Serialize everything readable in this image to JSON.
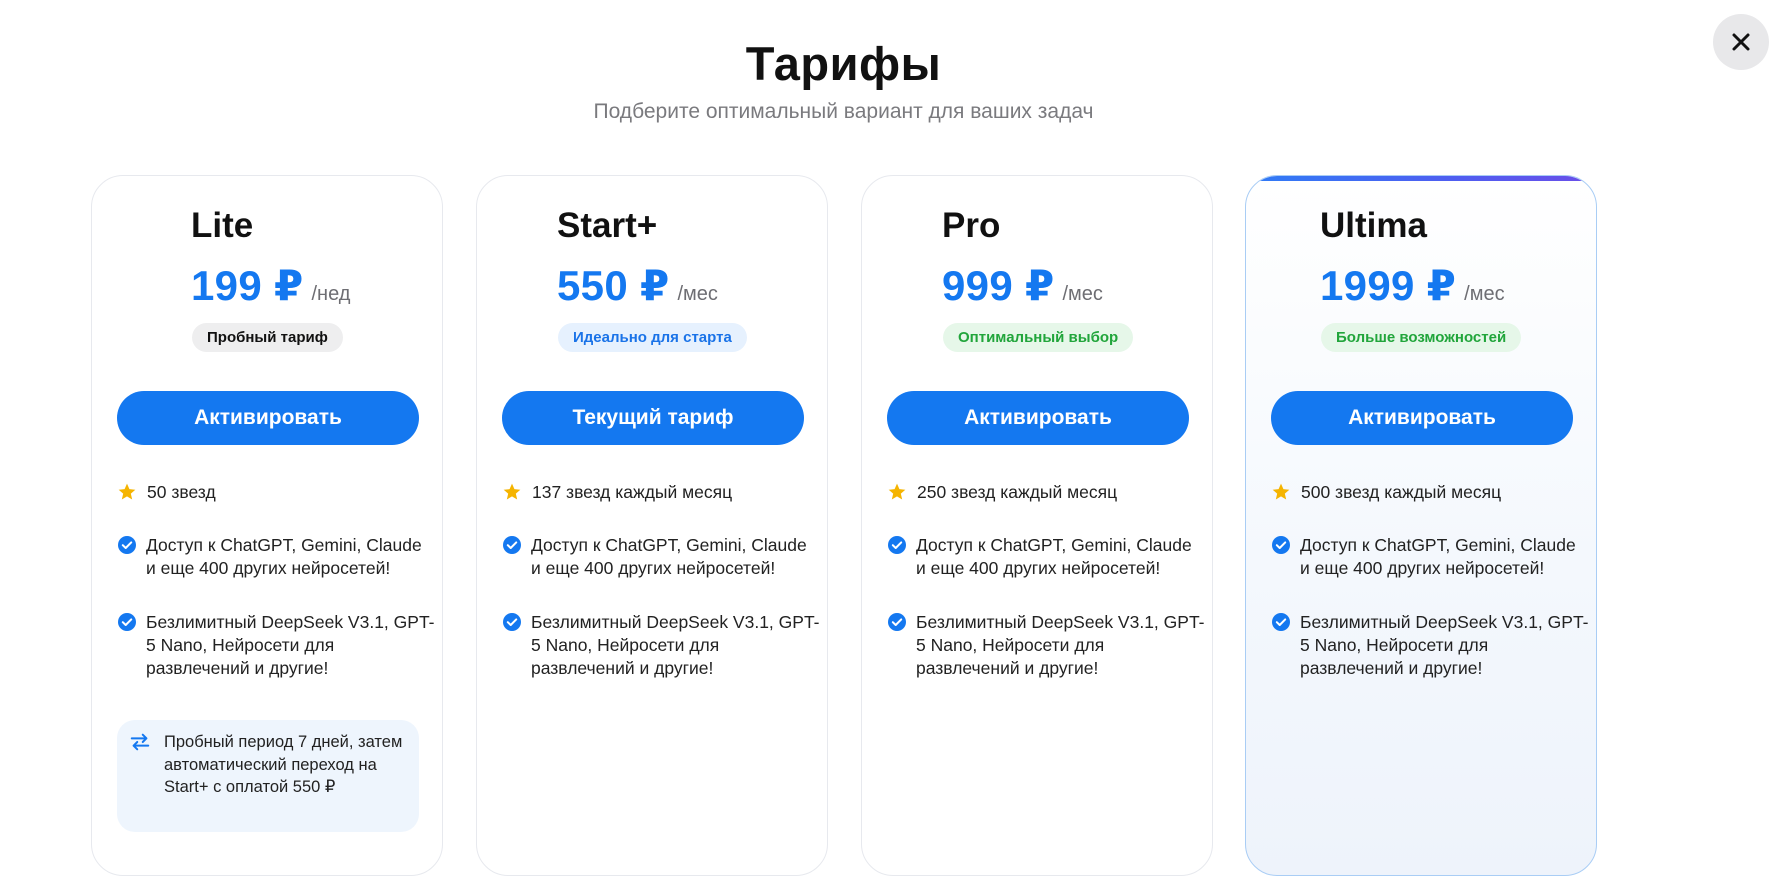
{
  "header": {
    "title": "Тарифы",
    "subtitle": "Подберите оптимальный вариант для ваших задач"
  },
  "close_icon": "close-icon",
  "colors": {
    "accent": "#1478f0",
    "badge_blue": "#1a73e8",
    "badge_green": "#21a53b",
    "star": "#f5b400"
  },
  "plans": [
    {
      "name": "Lite",
      "price": "199 ₽",
      "period": "/нед",
      "badge": "Пробный тариф",
      "button": "Активировать",
      "features": [
        "50 звезд",
        "Доступ к ChatGPT, Gemini, Claude и еще 400 других нейросетей!",
        "Безлимитный DeepSeek V3.1, GPT-5 Nano, Нейросети для развлечений и другие!"
      ],
      "note": "Пробный период 7 дней, затем автоматический переход на Start+ с оплатой 550 ₽"
    },
    {
      "name": "Start+",
      "price": "550 ₽",
      "period": "/мес",
      "badge": "Идеально для старта",
      "button": "Текущий тариф",
      "features": [
        "137 звезд каждый месяц",
        "Доступ к ChatGPT, Gemini, Claude и еще 400 других нейросетей!",
        "Безлимитный DeepSeek V3.1, GPT-5 Nano, Нейросети для развлечений и другие!"
      ]
    },
    {
      "name": "Pro",
      "price": "999 ₽",
      "period": "/мес",
      "badge": "Оптимальный выбор",
      "button": "Активировать",
      "features": [
        "250 звезд каждый месяц",
        "Доступ к ChatGPT, Gemini, Claude и еще 400 других нейросетей!",
        "Безлимитный DeepSeek V3.1, GPT-5 Nano, Нейросети для развлечений и другие!"
      ]
    },
    {
      "name": "Ultima",
      "price": "1999 ₽",
      "period": "/мес",
      "badge": "Больше возможностей",
      "button": "Активировать",
      "features": [
        "500 звезд каждый месяц",
        "Доступ к ChatGPT, Gemini, Claude и еще 400 других нейросетей!",
        "Безлимитный DeepSeek V3.1, GPT-5 Nano, Нейросети для развлечений и другие!"
      ]
    }
  ]
}
